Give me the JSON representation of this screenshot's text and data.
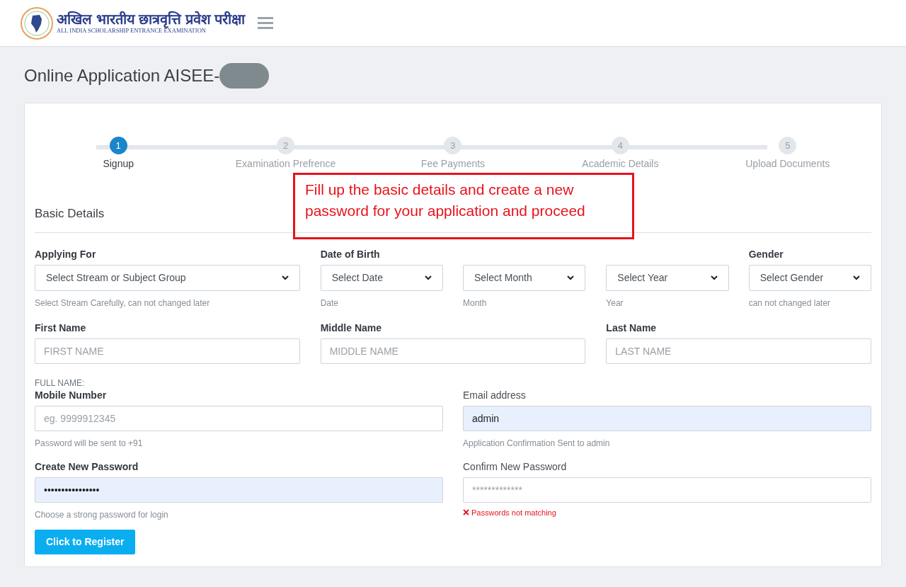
{
  "header": {
    "logo_title": "अखिल भारतीय छात्रवृत्ति प्रवेश परीक्षा",
    "logo_subtitle": "ALL INDIA SCHOLARSHIP ENTRANCE EXAMINATION"
  },
  "page_title": "Online Application AISEE-",
  "steps": [
    {
      "number": "1",
      "label": "Signup",
      "selected": true
    },
    {
      "number": "2",
      "label": "Examination Prefrence",
      "selected": false
    },
    {
      "number": "3",
      "label": "Fee Payments",
      "selected": false
    },
    {
      "number": "4",
      "label": "Academic Details",
      "selected": false
    },
    {
      "number": "5",
      "label": "Upload Documents",
      "selected": false
    }
  ],
  "annotation": "Fill up the basic details and create a new password for your application and proceed",
  "section_title": "Basic Details",
  "row1": [
    {
      "kind": "select",
      "label": "Applying For",
      "value": "Select Stream or Subject Group",
      "help": "Select Stream Carefully, can not changed later"
    },
    {
      "kind": "select",
      "label": "Date of Birth",
      "value": "Select Date",
      "help": "Date"
    },
    {
      "kind": "select",
      "value": "Select Month",
      "help": "Month"
    },
    {
      "kind": "select",
      "value": "Select Year",
      "help": "Year"
    },
    {
      "kind": "select",
      "label": "Gender",
      "value": "Select Gender",
      "help": "can not changed later"
    }
  ],
  "row2": [
    {
      "kind": "text",
      "label": "First Name",
      "placeholder": "FIRST NAME"
    },
    {
      "kind": "text",
      "label": "Middle Name",
      "placeholder": "MIDDLE NAME"
    },
    {
      "kind": "text",
      "label": "Last Name",
      "placeholder": "LAST NAME"
    }
  ],
  "full_name_label": "FULL NAME:",
  "row3": [
    {
      "kind": "text",
      "label": "Mobile Number",
      "bold": true,
      "placeholder": "eg. 9999912345",
      "autofilled": false,
      "help": "Password will be sent to +91"
    },
    {
      "kind": "text",
      "label": "Email address",
      "bold": false,
      "value": "admin",
      "autofilled": true,
      "help": "Application Confirmation Sent to admin"
    },
    {
      "kind": "text",
      "label": "Create New Password",
      "bold": true,
      "value": "••••••••••••••••",
      "autofilled": true,
      "help": "Choose a strong password for login"
    },
    {
      "kind": "text",
      "label": "Confirm New Password",
      "bold": false,
      "placeholder": "*************",
      "autofilled": false,
      "error": "Passwords not matching"
    }
  ],
  "register_button": "Click to Register"
}
